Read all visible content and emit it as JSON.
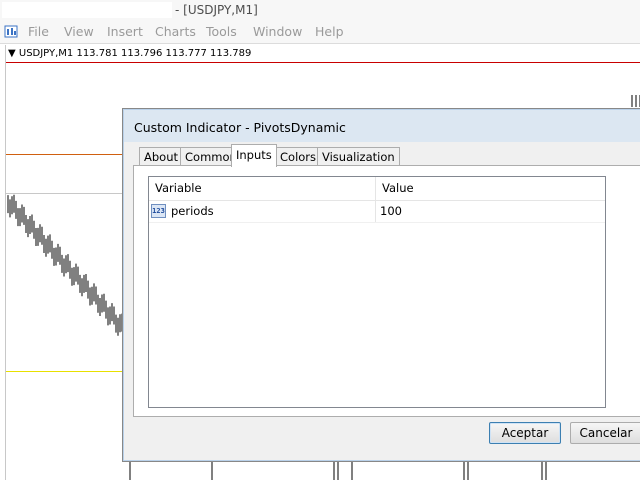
{
  "window": {
    "title": "- [USDJPY,M1]"
  },
  "menu": [
    "File",
    "View",
    "Insert",
    "Charts",
    "Tools",
    "Window",
    "Help"
  ],
  "chart": {
    "header": "▼ USDJPY,M1  113.781 113.796 113.777 113.789",
    "line_colors": {
      "red": "#c80000",
      "orange": "#d06010",
      "gray": "#c0c0c0",
      "yellow": "#e8e000"
    }
  },
  "dialog": {
    "title": "Custom Indicator - PivotsDynamic",
    "tabs": [
      "About",
      "Common",
      "Inputs",
      "Colors",
      "Visualization"
    ],
    "active_tab": "Inputs",
    "grid": {
      "headers": [
        "Variable",
        "Value"
      ],
      "rows": [
        {
          "icon": "123",
          "variable": "periods",
          "value": "100"
        }
      ]
    },
    "buttons": {
      "ok": "Aceptar",
      "cancel": "Cancelar"
    }
  }
}
